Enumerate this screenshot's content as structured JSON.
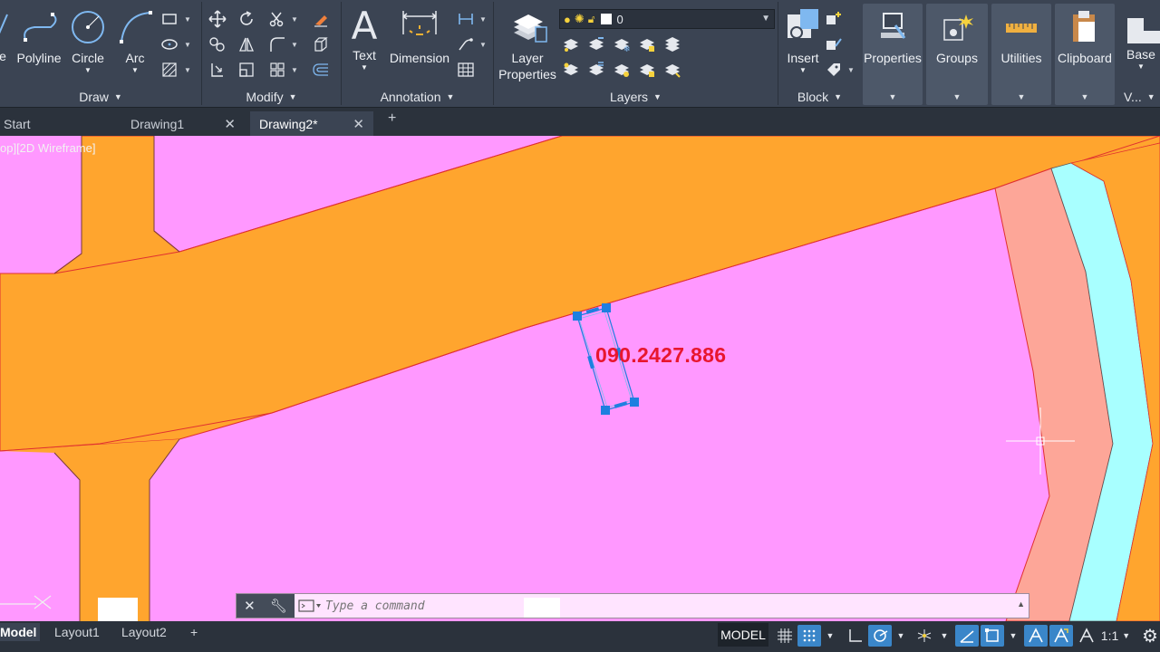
{
  "ribbon": {
    "draw": {
      "panel_label": "Draw",
      "line_label": "e",
      "polyline_label": "Polyline",
      "circle_label": "Circle",
      "arc_label": "Arc"
    },
    "modify": {
      "panel_label": "Modify"
    },
    "annotation": {
      "panel_label": "Annotation",
      "text_label": "Text",
      "dimension_label": "Dimension"
    },
    "layers": {
      "panel_label": "Layers",
      "layer_properties_line1": "Layer",
      "layer_properties_line2": "Properties",
      "current_layer": "0"
    },
    "block": {
      "panel_label": "Block",
      "insert_label": "Insert"
    },
    "properties_label": "Properties",
    "groups_label": "Groups",
    "utilities_label": "Utilities",
    "clipboard_label": "Clipboard",
    "base_label": "Base",
    "view_label": "V..."
  },
  "tabs": {
    "start": "Start",
    "drawing1": "Drawing1",
    "drawing2": "Drawing2*"
  },
  "canvas": {
    "viewport_label": "op][2D Wireframe]",
    "annotation_text": "090.2427.886",
    "colors": {
      "lot_fill": "#ff98ff",
      "road_fill": "#ffa52e",
      "strip_fill": "#fda698",
      "water_fill": "#a8ffff",
      "text_color": "#e8162e",
      "grip_color": "#1e7fe0"
    }
  },
  "command": {
    "placeholder": "Type a command"
  },
  "status": {
    "model_tab": "Model",
    "layout1": "Layout1",
    "layout2": "Layout2",
    "model_button": "MODEL",
    "scale": "1:1"
  }
}
